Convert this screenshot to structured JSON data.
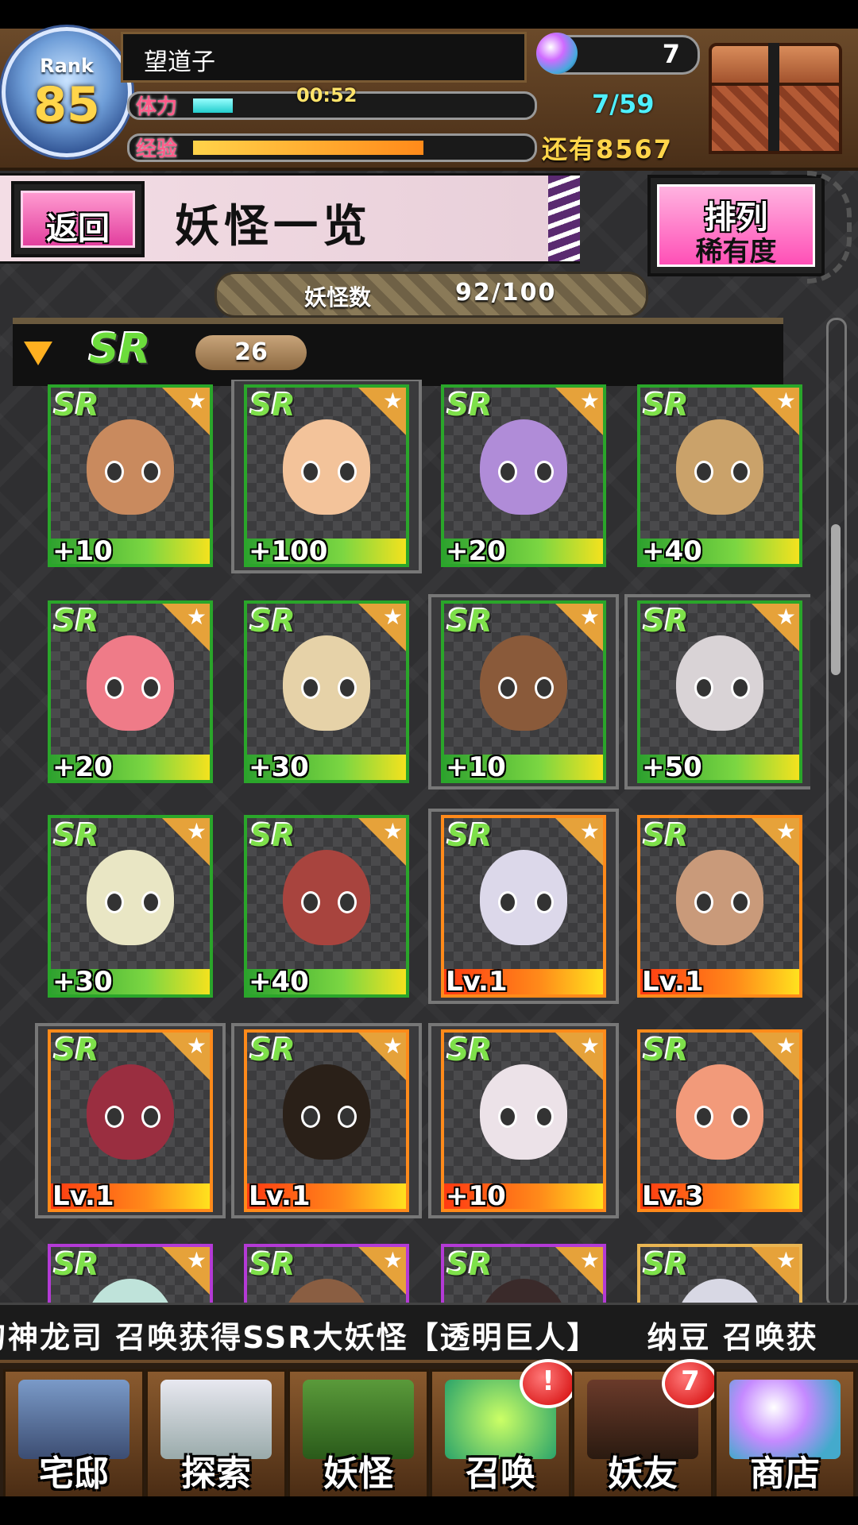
{
  "header": {
    "rank_label": "Rank",
    "rank_value": "85",
    "player_name": "望道子",
    "stamina_label": "体力",
    "stamina_timer": "00:52",
    "stamina_value": "7/59",
    "exp_label": "经验",
    "exp_remaining": "还有8567",
    "gems": "7"
  },
  "title_row": {
    "back_label": "返回",
    "page_title": "妖怪一览",
    "sort_label_1": "排列",
    "sort_label_2": "稀有度"
  },
  "count": {
    "label": "妖怪数",
    "value": "92/100"
  },
  "section": {
    "rarity": "SR",
    "count": "26"
  },
  "cards": [
    {
      "rarity": "SR",
      "level": "+10",
      "frame": "green"
    },
    {
      "rarity": "SR",
      "level": "+100",
      "frame": "green"
    },
    {
      "rarity": "SR",
      "level": "+20",
      "frame": "green"
    },
    {
      "rarity": "SR",
      "level": "+40",
      "frame": "green"
    },
    {
      "rarity": "SR",
      "level": "+20",
      "frame": "green"
    },
    {
      "rarity": "SR",
      "level": "+30",
      "frame": "green"
    },
    {
      "rarity": "SR",
      "level": "+10",
      "frame": "green"
    },
    {
      "rarity": "SR",
      "level": "+50",
      "frame": "green"
    },
    {
      "rarity": "SR",
      "level": "+30",
      "frame": "green"
    },
    {
      "rarity": "SR",
      "level": "+40",
      "frame": "green"
    },
    {
      "rarity": "SR",
      "level": "Lv.1",
      "frame": "orange"
    },
    {
      "rarity": "SR",
      "level": "Lv.1",
      "frame": "orange"
    },
    {
      "rarity": "SR",
      "level": "Lv.1",
      "frame": "orange"
    },
    {
      "rarity": "SR",
      "level": "Lv.1",
      "frame": "orange"
    },
    {
      "rarity": "SR",
      "level": "+10",
      "frame": "orange"
    },
    {
      "rarity": "SR",
      "level": "Lv.3",
      "frame": "orange"
    },
    {
      "rarity": "SR",
      "level": "",
      "frame": "purple"
    },
    {
      "rarity": "SR",
      "level": "",
      "frame": "purple"
    },
    {
      "rarity": "SR",
      "level": "",
      "frame": "purple"
    },
    {
      "rarity": "SR",
      "level": "",
      "frame": "tan"
    }
  ],
  "ticker": "刀神龙司 召唤获得SSR大妖怪【透明巨人】　　纳豆 召唤获",
  "nav": [
    {
      "label": "宅邸",
      "icon": "mansion-icon",
      "badge": ""
    },
    {
      "label": "探索",
      "icon": "magnifier-map-icon",
      "badge": ""
    },
    {
      "label": "妖怪",
      "icon": "scroll-icon",
      "badge": ""
    },
    {
      "label": "召唤",
      "icon": "pentagram-icon",
      "badge": "!"
    },
    {
      "label": "妖友",
      "icon": "friend-icon",
      "badge": "7"
    },
    {
      "label": "商店",
      "icon": "orb-icon",
      "badge": ""
    }
  ],
  "colors": {
    "frame_green": "#2aa62a",
    "frame_orange": "#ff8a1a",
    "frame_purple": "#b43ad6",
    "accent_pink": "#ff4fb6",
    "sr_green": "#7ee04a"
  }
}
